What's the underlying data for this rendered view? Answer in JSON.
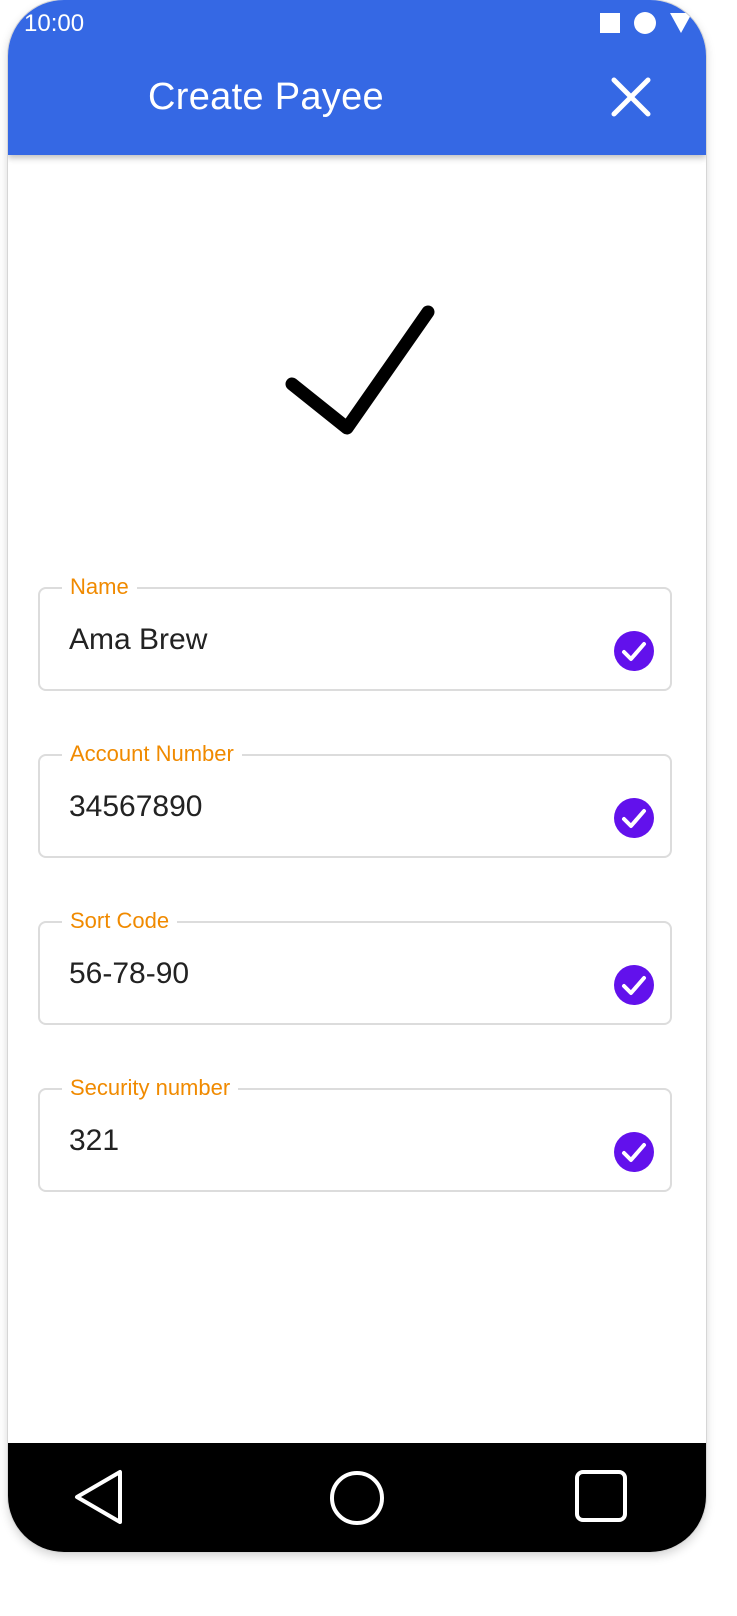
{
  "status_bar": {
    "time": "10:00",
    "icons": [
      "stop-square-icon",
      "record-circle-icon",
      "signal-triangle-icon"
    ]
  },
  "app_bar": {
    "title": "Create Payee",
    "close_icon": "close-icon"
  },
  "success_icon": "checkmark-icon",
  "fields": [
    {
      "label": "Name",
      "value": "Ama Brew",
      "status": "valid"
    },
    {
      "label": "Account Number",
      "value": "34567890",
      "status": "valid"
    },
    {
      "label": "Sort Code",
      "value": "56-78-90",
      "status": "valid"
    },
    {
      "label": "Security number",
      "value": "321",
      "status": "valid"
    }
  ],
  "nav_bar": {
    "buttons": [
      "back-icon",
      "home-icon",
      "recents-icon"
    ]
  },
  "colors": {
    "app_bar": "#3568e4",
    "field_label": "#f08a00",
    "valid_badge": "#6211ec",
    "nav_bar": "#000000"
  }
}
